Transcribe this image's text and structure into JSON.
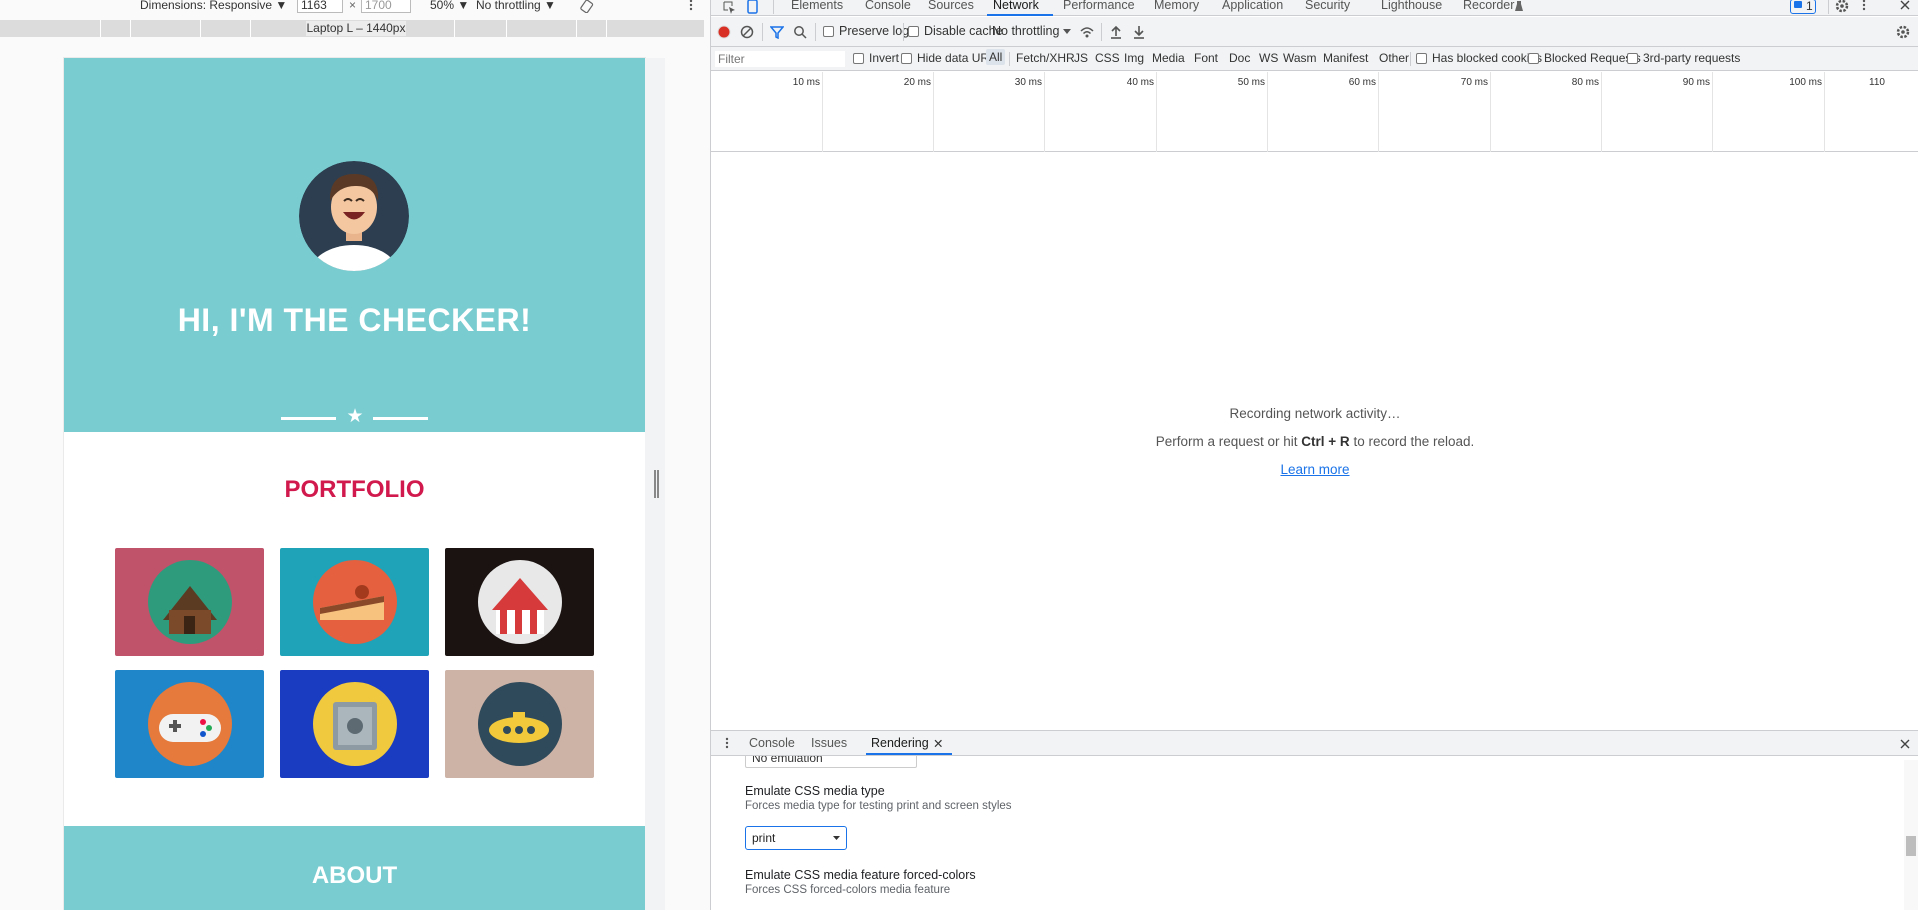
{
  "device_toolbar": {
    "dimensions_label": "Dimensions: Responsive ▼",
    "width_value": "1163",
    "times": "×",
    "height_placeholder": "1700",
    "zoom": "50% ▼",
    "throttle": "No throttling ▼",
    "media_query_label": "Laptop L – 1440px"
  },
  "page": {
    "hero_title": "HI, I'M THE CHECKER!",
    "portfolio_title": "PORTFOLIO",
    "about_title": "ABOUT",
    "star": "★",
    "tile_colors": [
      "#c0526a",
      "#1fa3b8",
      "#1b1312",
      "#1f87c9",
      "#1a3cc0",
      "#cdb2a6"
    ]
  },
  "devtools": {
    "tabs": [
      "Elements",
      "Console",
      "Sources",
      "Network",
      "Performance",
      "Memory",
      "Application",
      "Security",
      "Lighthouse",
      "Recorder"
    ],
    "issues_count": "1",
    "toolbar": {
      "preserve_log": "Preserve log",
      "disable_cache": "Disable cache",
      "throttling": "No throttling"
    },
    "filter": {
      "placeholder": "Filter",
      "invert": "Invert",
      "hide_data_urls": "Hide data URLs",
      "types": [
        "All",
        "Fetch/XHR",
        "JS",
        "CSS",
        "Img",
        "Media",
        "Font",
        "Doc",
        "WS",
        "Wasm",
        "Manifest",
        "Other"
      ],
      "has_blocked_cookies": "Has blocked cookies",
      "blocked_requests": "Blocked Requests",
      "third_party": "3rd-party requests"
    },
    "timeline_ticks": [
      "10 ms",
      "20 ms",
      "30 ms",
      "40 ms",
      "50 ms",
      "60 ms",
      "70 ms",
      "80 ms",
      "90 ms",
      "100 ms",
      "110"
    ],
    "empty": {
      "line1": "Recording network activity…",
      "line2_pre": "Perform a request or hit ",
      "line2_key": "Ctrl + R",
      "line2_post": " to record the reload.",
      "learn_more": "Learn more"
    },
    "drawer": {
      "tabs": [
        "Console",
        "Issues",
        "Rendering"
      ],
      "close_x": "✕",
      "cut_value": "No emulation",
      "media_type_title": "Emulate CSS media type",
      "media_type_desc": "Forces media type for testing print and screen styles",
      "media_type_value": "print",
      "forced_colors_title": "Emulate CSS media feature forced-colors",
      "forced_colors_desc": "Forces CSS forced-colors media feature"
    }
  }
}
